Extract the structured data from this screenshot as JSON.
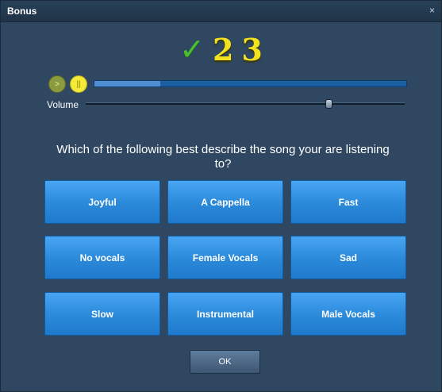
{
  "window": {
    "title": "Bonus",
    "close_label": "×"
  },
  "score": {
    "check_icon": "✓",
    "first": "2",
    "second": "3"
  },
  "player": {
    "play_icon": ">",
    "pause_icon": "||",
    "progress_fraction": 0.21,
    "volume_label": "Volume",
    "volume_fraction": 0.76
  },
  "question": "Which of the following best describe the song your are listening to?",
  "answers": [
    {
      "label": "Joyful"
    },
    {
      "label": "A Cappella"
    },
    {
      "label": "Fast"
    },
    {
      "label": "No vocals"
    },
    {
      "label": "Female Vocals"
    },
    {
      "label": "Sad"
    },
    {
      "label": "Slow"
    },
    {
      "label": "Instrumental"
    },
    {
      "label": "Male Vocals"
    }
  ],
  "ok_label": "OK",
  "colors": {
    "accent": "#2d8cdc",
    "check": "#4bbf2f",
    "score": "#f2e21f"
  }
}
